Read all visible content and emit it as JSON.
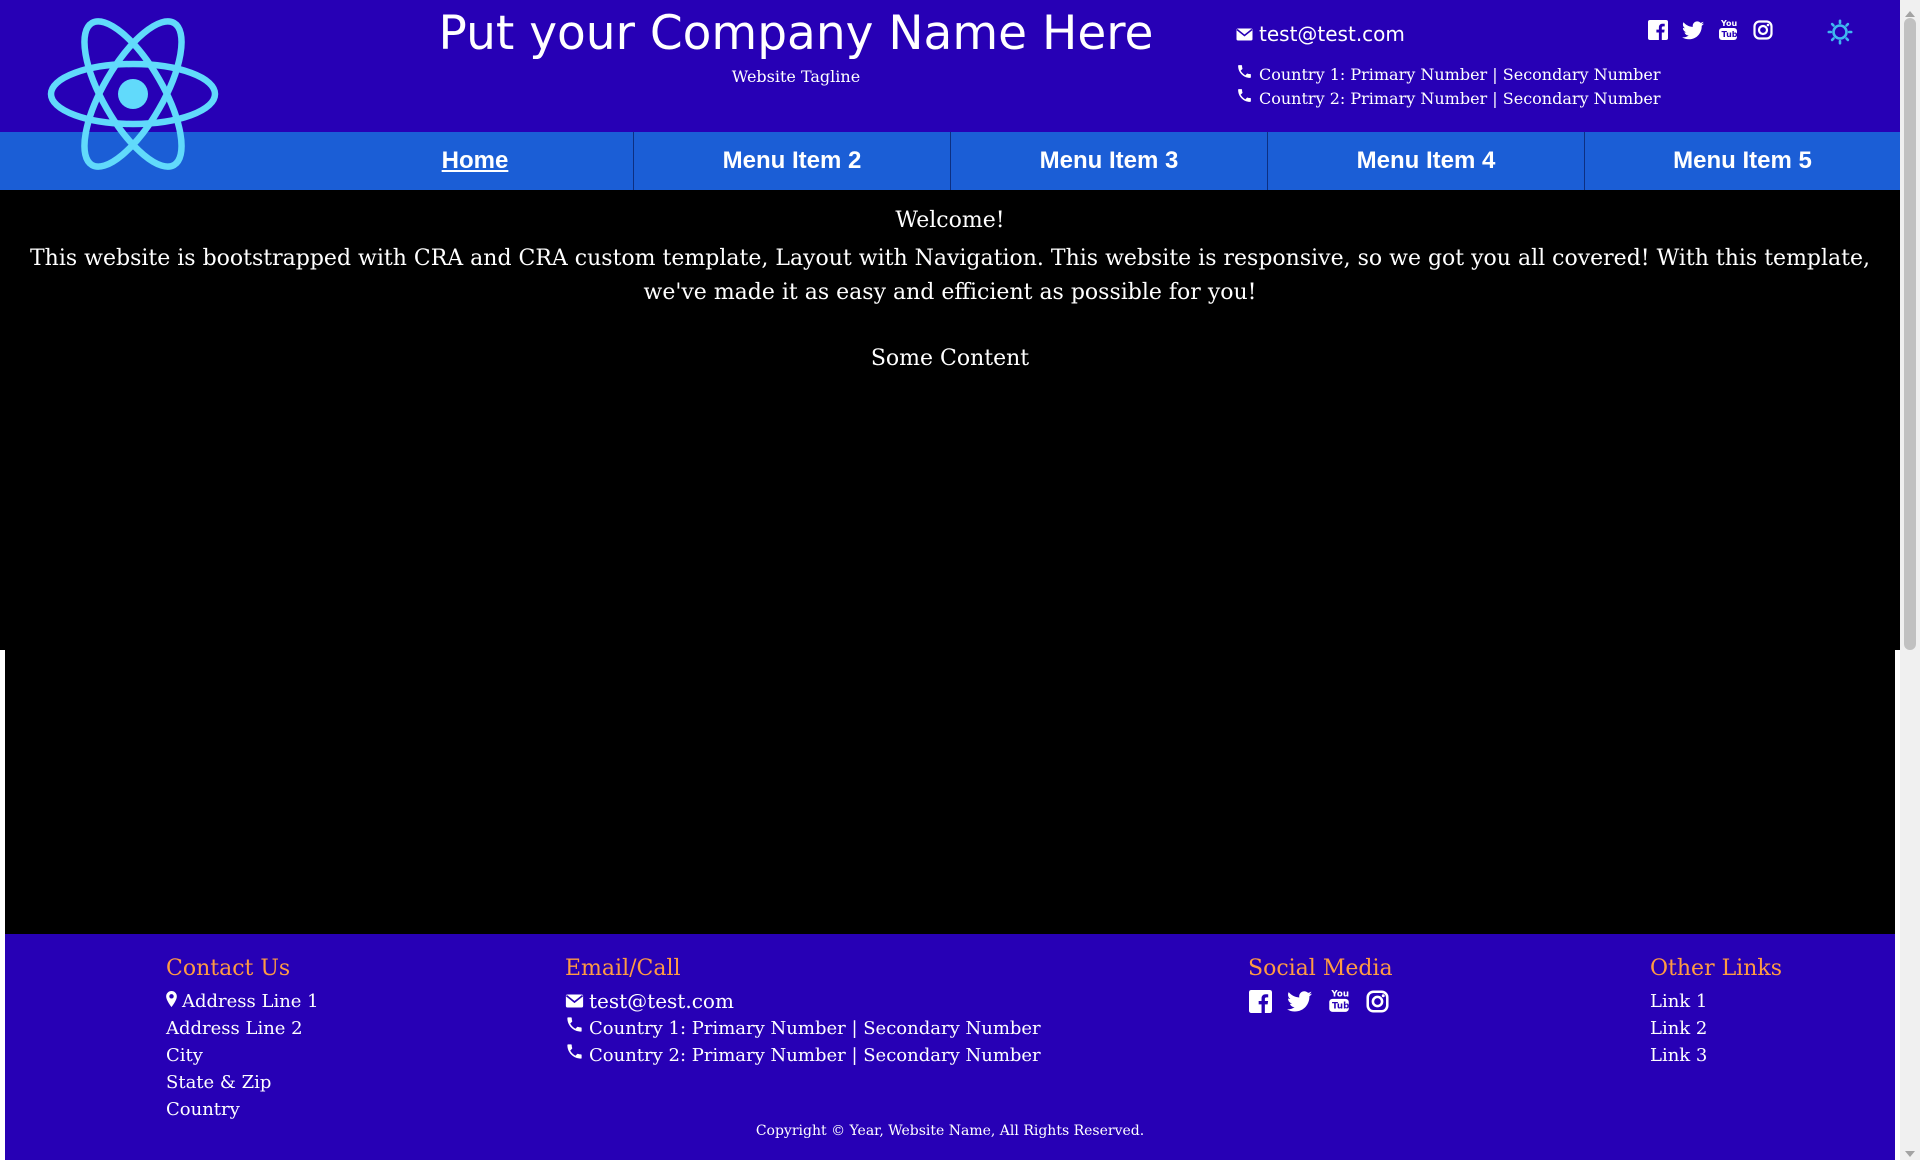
{
  "header": {
    "company_name": "Put your Company Name Here",
    "tagline": "Website Tagline",
    "email": "test@test.com",
    "phone_1": "Country 1: Primary Number | Secondary Number",
    "phone_2": "Country 2: Primary Number | Secondary Number",
    "social_icons": [
      "facebook-icon",
      "twitter-icon",
      "youtube-icon",
      "instagram-icon"
    ],
    "theme_icon": "sun-icon"
  },
  "nav": {
    "items": [
      {
        "label": "Home",
        "active": true
      },
      {
        "label": "Menu Item 2",
        "active": false
      },
      {
        "label": "Menu Item 3",
        "active": false
      },
      {
        "label": "Menu Item 4",
        "active": false
      },
      {
        "label": "Menu Item 5",
        "active": false
      }
    ]
  },
  "main": {
    "welcome": "Welcome!",
    "description": "This website is bootstrapped with CRA and CRA custom template, Layout with Navigation. This website is responsive, so we got you all covered! With this template, we've made it as easy and efficient as possible for you!",
    "content": "Some Content"
  },
  "footer": {
    "contact": {
      "heading": "Contact Us",
      "lines": [
        "Address Line 1",
        "Address Line 2",
        "City",
        "State & Zip",
        "Country"
      ]
    },
    "email_call": {
      "heading": "Email/Call",
      "email": "test@test.com",
      "phone_1": "Country 1: Primary Number | Secondary Number",
      "phone_2": "Country 2: Primary Number | Secondary Number"
    },
    "social": {
      "heading": "Social Media",
      "icons": [
        "facebook-icon",
        "twitter-icon",
        "youtube-icon",
        "instagram-icon"
      ]
    },
    "links": {
      "heading": "Other Links",
      "items": [
        "Link 1",
        "Link 2",
        "Link 3"
      ]
    },
    "copyright": "Copyright © Year,  Website Name, All Rights Reserved."
  },
  "colors": {
    "header_bg": "#2700b5",
    "nav_bg": "#1b5ed6",
    "main_bg": "#000000",
    "footer_heading": "#ff9b42",
    "logo": "#61dafb"
  }
}
